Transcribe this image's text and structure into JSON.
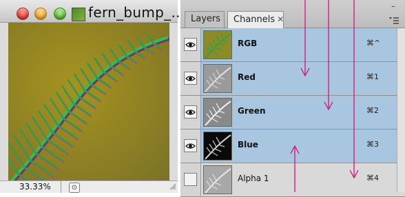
{
  "document": {
    "title": "fern_bump_...",
    "zoom": "33.33%"
  },
  "panel": {
    "tabs": [
      {
        "label": "Layers",
        "active": false
      },
      {
        "label": "Channels",
        "active": true
      }
    ],
    "channels": [
      {
        "name": "RGB",
        "shortcut": "⌘^",
        "visible": true,
        "selected": true
      },
      {
        "name": "Red",
        "shortcut": "⌘1",
        "visible": true,
        "selected": true
      },
      {
        "name": "Green",
        "shortcut": "⌘2",
        "visible": true,
        "selected": true
      },
      {
        "name": "Blue",
        "shortcut": "⌘3",
        "visible": true,
        "selected": true
      },
      {
        "name": "Alpha 1",
        "shortcut": "⌘4",
        "visible": false,
        "selected": false
      }
    ]
  },
  "colors": {
    "selection": "#a9c6e0",
    "annotation_arrow": "#d6107a",
    "canvas_bg": "#8f8124",
    "fern_green": "#2aa04a"
  }
}
